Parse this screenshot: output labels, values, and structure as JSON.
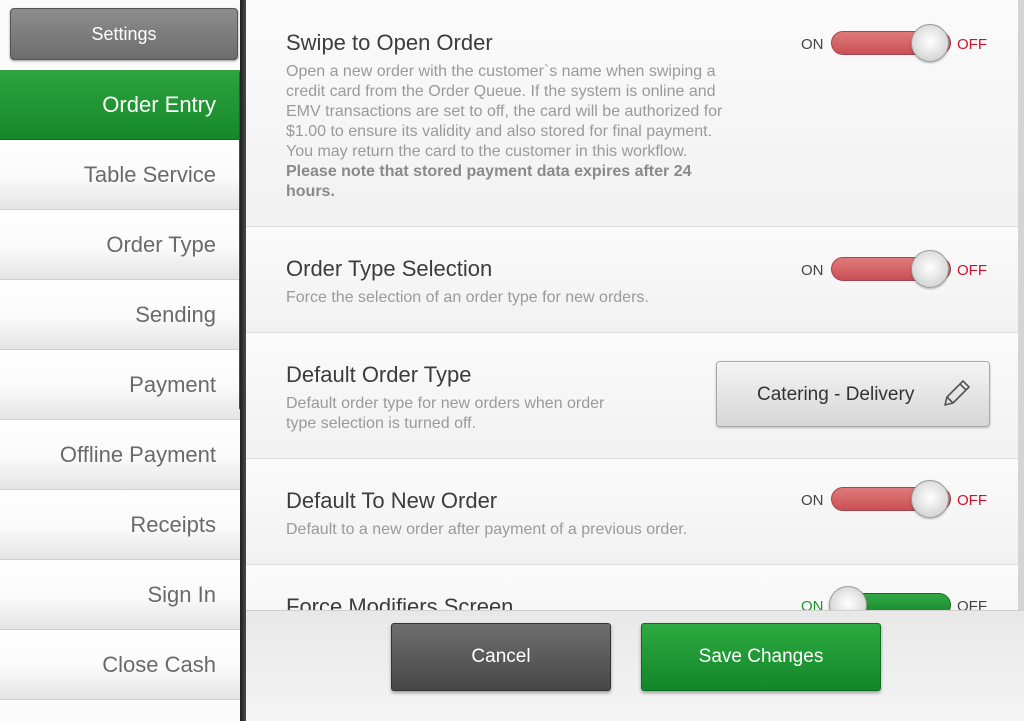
{
  "sidebar": {
    "header": "Settings",
    "items": [
      {
        "label": "Order Entry",
        "active": true
      },
      {
        "label": "Table Service"
      },
      {
        "label": "Order Type"
      },
      {
        "label": "Sending"
      },
      {
        "label": "Payment"
      },
      {
        "label": "Offline Payment"
      },
      {
        "label": "Receipts"
      },
      {
        "label": "Sign In"
      },
      {
        "label": "Close Cash"
      }
    ]
  },
  "settings": [
    {
      "title": "Swipe to Open Order",
      "description": "Open a new order with the customer`s name when swiping a credit card from the Order Queue. If the system is online and EMV transactions are set to off, the card will be authorized for $1.00 to ensure its validity and also stored for final payment. You may return the card to the customer in this workflow.",
      "description_bold": "Please note that stored payment data expires after 24 hours.",
      "toggle": {
        "on_label": "ON",
        "off_label": "OFF",
        "state": "off"
      }
    },
    {
      "title": "Order Type Selection",
      "description": "Force the selection of an order type for new orders.",
      "toggle": {
        "on_label": "ON",
        "off_label": "OFF",
        "state": "off"
      }
    },
    {
      "title": "Default Order Type",
      "description": "Default order type for new orders when order type selection is turned off.",
      "selected_value": "Catering - Delivery",
      "edit_icon": "pencil-icon"
    },
    {
      "title": "Default To New Order",
      "description": "Default to a new order after payment of a previous order.",
      "toggle": {
        "on_label": "ON",
        "off_label": "OFF",
        "state": "off"
      }
    },
    {
      "title": "Force Modifiers Screen",
      "toggle": {
        "on_label": "ON",
        "off_label": "OFF",
        "state": "on"
      }
    }
  ],
  "footer": {
    "cancel_label": "Cancel",
    "save_label": "Save Changes"
  },
  "colors": {
    "active_green": "#1f9a35",
    "toggle_off_red": "#c94f55",
    "off_text_red": "#d0112b"
  }
}
